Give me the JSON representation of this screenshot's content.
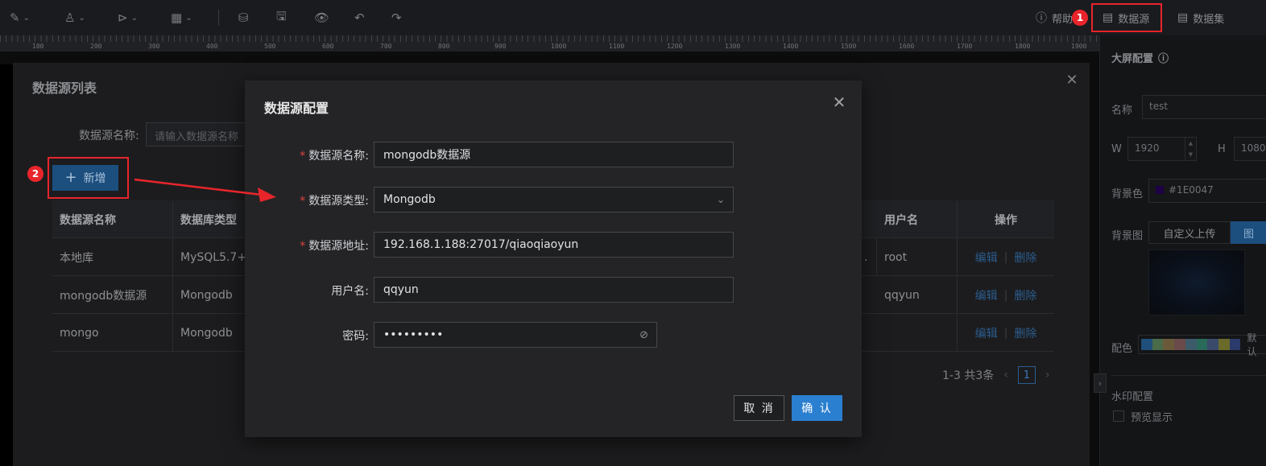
{
  "toolbar": {
    "help_label": "帮助",
    "datasource_label": "数据源",
    "dataset_label": "数据集"
  },
  "ruler": {
    "labels": [
      "100",
      "200",
      "300",
      "400",
      "500",
      "600",
      "700",
      "800",
      "900",
      "1000",
      "1100",
      "1200",
      "1300",
      "1400",
      "1500",
      "1600",
      "1700",
      "1800",
      "1900"
    ]
  },
  "list_panel": {
    "title": "数据源列表",
    "search_label": "数据源名称:",
    "search_placeholder": "请输入数据源名称",
    "add_button": "新增",
    "columns": [
      "数据源名称",
      "数据库类型",
      "用户名",
      "操作"
    ],
    "rows": [
      {
        "name": "本地库",
        "type": "MySQL5.7+",
        "hidden_tail": ".",
        "user": "root"
      },
      {
        "name": "mongodb数据源",
        "type": "Mongodb",
        "hidden_tail": "",
        "user": "qqyun"
      },
      {
        "name": "mongo",
        "type": "Mongodb",
        "hidden_tail": "",
        "user": ""
      }
    ],
    "edit_label": "编辑",
    "delete_label": "删除",
    "pager_text": "1-3 共3条",
    "pager_page": "1"
  },
  "right_panel": {
    "title": "大屏配置",
    "name_label": "名称",
    "name_value": "test",
    "w_label": "W",
    "w_value": "1920",
    "h_label": "H",
    "h_value": "1080",
    "bg_color_label": "背景色",
    "bg_color_value": "#1E0047",
    "bg_image_label": "背景图",
    "upload_tab": "自定义上传",
    "image_tab": "图",
    "palette_label": "配色",
    "palette_default": "默认",
    "palette_colors": [
      "#1f4f7a",
      "#4a6b4a",
      "#6a5a3a",
      "#6a4a4a",
      "#3d5a6a",
      "#2a6a5a",
      "#3a4a6a",
      "#6a6a2a",
      "#2a3a6a"
    ],
    "watermark_label": "水印配置",
    "preview_label": "预览显示"
  },
  "modal": {
    "title": "数据源配置",
    "fields": {
      "name_label": "数据源名称:",
      "name_value": "mongodb数据源",
      "type_label": "数据源类型:",
      "type_value": "Mongodb",
      "address_label": "数据源地址:",
      "address_value": "192.168.1.188:27017/qiaoqiaoyun",
      "user_label": "用户名:",
      "user_value": "qqyun",
      "password_label": "密码:",
      "password_value": "•••••••••"
    },
    "cancel_label": "取 消",
    "ok_label": "确 认"
  },
  "annotations": {
    "badge1": "1",
    "badge2": "2",
    "accent": "#e8252b"
  }
}
